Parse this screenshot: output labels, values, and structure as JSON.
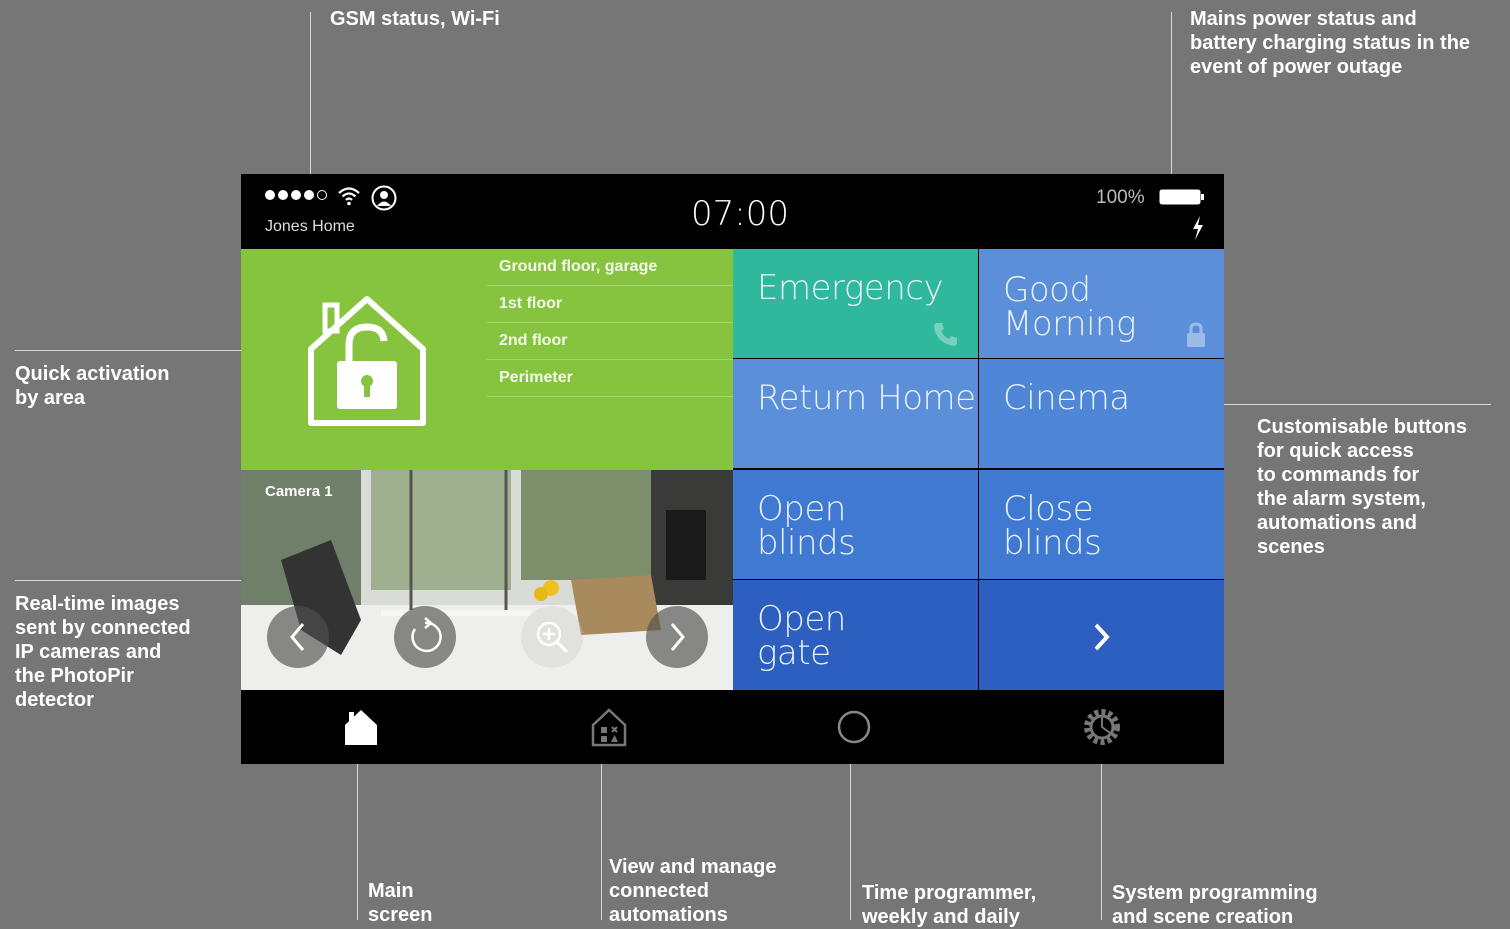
{
  "statusbar": {
    "home_name": "Jones Home",
    "time": "07:00",
    "battery_percent": "100%",
    "signal_bars_filled": 4,
    "signal_bars_total": 5
  },
  "areas": {
    "items": [
      "Ground floor, garage",
      "1st floor",
      "2nd floor",
      "Perimeter"
    ]
  },
  "camera": {
    "label": "Camera 1"
  },
  "tiles": [
    {
      "label_line1": "Emergency",
      "label_line2": "",
      "color": "#2fb89c",
      "icon": "phone-icon"
    },
    {
      "label_line1": "Good",
      "label_line2": "Morning",
      "color": "#5b8fd9",
      "icon": "lock-icon"
    },
    {
      "label_line1": "Return Home",
      "label_line2": "",
      "color": "#5b8fd9",
      "icon": ""
    },
    {
      "label_line1": "Cinema",
      "label_line2": "",
      "color": "#4f86d6",
      "icon": ""
    },
    {
      "label_line1": "Open",
      "label_line2": "blinds",
      "color": "#3f79d2",
      "icon": ""
    },
    {
      "label_line1": "Close",
      "label_line2": "blinds",
      "color": "#3f79d2",
      "icon": ""
    },
    {
      "label_line1": "Open",
      "label_line2": "gate",
      "color": "#2d5fc0",
      "icon": ""
    },
    {
      "label_line1": "",
      "label_line2": "",
      "color": "#2d5fc0",
      "icon": "chevron-right-icon"
    }
  ],
  "nav": [
    {
      "icon": "home-icon"
    },
    {
      "icon": "automation-house-icon"
    },
    {
      "icon": "clock-icon"
    },
    {
      "icon": "gear-icon"
    }
  ],
  "callouts": {
    "gsm_wifi": "GSM status, Wi-Fi",
    "mains_power": [
      "Mains power status and",
      "battery charging status in the",
      "event of power outage"
    ],
    "quick_activation": [
      "Quick activation",
      "by area"
    ],
    "real_time_images": [
      "Real-time images",
      "sent by connected",
      "IP cameras and",
      "the PhotoPir",
      "detector"
    ],
    "customisable_buttons": [
      "Customisable buttons",
      "for quick access",
      "to commands for",
      "the alarm system,",
      "automations and",
      "scenes"
    ],
    "main_screen": [
      "Main",
      "screen"
    ],
    "view_manage": [
      "View and manage",
      "connected",
      "automations"
    ],
    "time_programmer": [
      "Time programmer,",
      "weekly and daily"
    ],
    "system_programming": [
      "System programming",
      "and scene creation"
    ]
  },
  "colors": {
    "background": "#767676",
    "area_green": "#86c440",
    "emergency_teal": "#2fb89c",
    "tile_blue": "#4f86d6",
    "tile_dark_blue": "#2d5fc0"
  }
}
